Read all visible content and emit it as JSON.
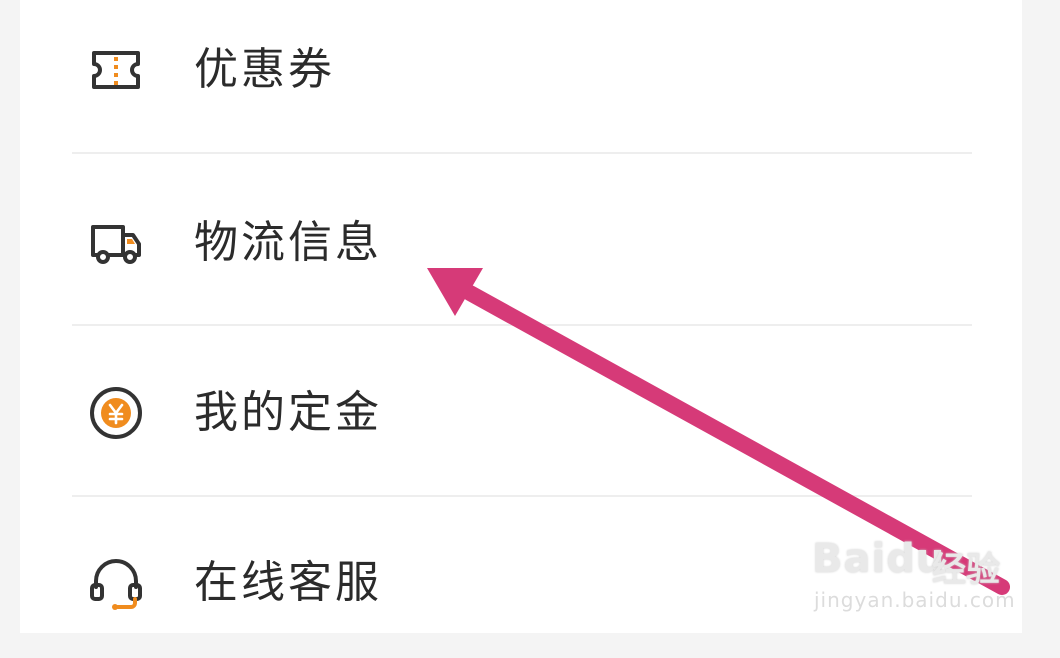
{
  "menu": {
    "items": [
      {
        "label": "优惠券",
        "icon": "coupon-icon"
      },
      {
        "label": "物流信息",
        "icon": "truck-icon"
      },
      {
        "label": "我的定金",
        "icon": "yuan-coin-icon"
      },
      {
        "label": "在线客服",
        "icon": "headset-icon"
      }
    ]
  },
  "colors": {
    "accent": "#f08c1e",
    "icon_stroke": "#333333",
    "arrow": "#d63a78",
    "divider": "#eeeeee"
  },
  "watermark": {
    "logo": "Baidu",
    "logo_suffix": "经验",
    "url": "jingyan.baidu.com"
  }
}
